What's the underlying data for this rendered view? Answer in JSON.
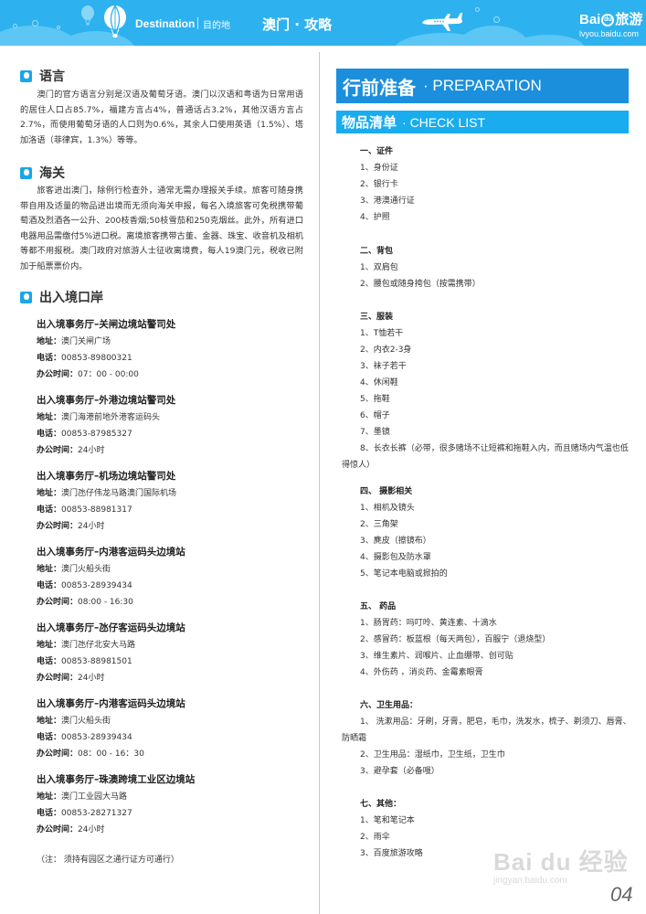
{
  "header": {
    "destination_label": "Destination",
    "destination_cn": "目的地",
    "title": "澳门 · 攻略",
    "logo_main": "Bai",
    "logo_paw": "du",
    "logo_cn": "旅游",
    "logo_url": "lvyou.baidu.com"
  },
  "left": {
    "language": {
      "title": "语言",
      "body": "澳门的官方语言分别是汉语及葡萄牙语。澳门以汉语和粤语为日常用语的居住人口占85.7%，福建方言占4%，普通话占3.2%，其他汉语方言占2.7%，而使用葡萄牙语的人口则为0.6%，其余人口使用英语（1.5%）、塔加洛语（菲律宾，1.3%）等等。"
    },
    "customs": {
      "title": "海关",
      "body": "旅客进出澳门，除例行检查外，通常无需办理报关手续。旅客可随身携带自用及适量的物品进出境而无须向海关申报，每名入境旅客可免税携带葡萄酒及烈酒各一公升、200枝香烟;50枝雪茄和250克烟丝。此外，所有进口电器用品需缴付5%进口税。离境旅客携带古董、金器、珠宝、收音机及相机等都不用报税。澳门政府对旅游人士征收离境费，每人19澳门元，税收已附加于船票票价内。"
    },
    "ports": {
      "title": "出入境口岸",
      "labels": {
        "address": "地址：",
        "phone": "电话：",
        "hours": "办公时间："
      },
      "offices": [
        {
          "name": "出入境事务厅–关闸边境站警司处",
          "address": "澳门关闸广场",
          "phone": "00853-89800321",
          "hours": "07：00 - 00:00"
        },
        {
          "name": "出入境事务厅–外港边境站警司处",
          "address": "澳门海港前地外港客运码头",
          "phone": "00853-87985327",
          "hours": "24小时"
        },
        {
          "name": "出入境事务厅–机场边境站警司处",
          "address": "澳门氹仔伟龙马路澳门国际机场",
          "phone": "00853-88981317",
          "hours": "24小时"
        },
        {
          "name": "出入境事务厅–内港客运码头边境站",
          "address": "澳门火船头街",
          "phone": "00853-28939434",
          "hours": "08:00 - 16:30"
        },
        {
          "name": "出入境事务厅–氹仔客运码头边境站",
          "address": "澳门氹仔北安大马路",
          "phone": "00853-88981501",
          "hours": "24小时"
        },
        {
          "name": "出入境事务厅–内港客运码头边境站",
          "address": "澳门火船头街",
          "phone": "00853-28939434",
          "hours": "08：00 - 16：30"
        },
        {
          "name": "出入境事务厅–珠澳跨境工业区边境站",
          "address": "澳门工业园大马路",
          "phone": "00853-28271327",
          "hours": "24小时"
        }
      ],
      "note": "（注： 须持有园区之通行证方可通行）"
    }
  },
  "right": {
    "banner_main_cn": "行前准备",
    "banner_main_en": "· PREPARATION",
    "banner_sub_cn": "物品清单",
    "banner_sub_en": "· CHECK LIST",
    "categories": [
      {
        "title": "一、证件",
        "items": [
          "1、身份证",
          "2、银行卡",
          "3、港澳通行证",
          "4、护照"
        ]
      },
      {
        "title": "二、背包",
        "items": [
          "1、双肩包",
          "2、腰包或随身挎包（按需携带）"
        ]
      },
      {
        "title": "三、服装",
        "items": [
          "1、T恤若干",
          "2、内衣2-3身",
          "3、袜子若干",
          "4、休闲鞋",
          "5、拖鞋",
          "6、帽子",
          "7、墨镜",
          "8、长衣长裤（必带，很多赌场不让短裤和拖鞋入内，而且赌场内气温也低得惊人）"
        ]
      },
      {
        "title": "四、 摄影相关",
        "items": [
          "1、相机及镜头",
          "2、三角架",
          "3、麂皮（擦镜布）",
          "4、摄影包及防水罩",
          "5、笔记本电脑或掀拍的"
        ]
      },
      {
        "title": "五、 药品",
        "items": [
          "1、肠胃药：吗叮呤、黄连素、十滴水",
          "2、感冒药：板蓝根（每天两包），百服宁（退烧型）",
          "3、维生素片、润喉片、止血绷带、创可贴",
          "4、外伤药 ，消炎药、金霉素眼膏"
        ]
      },
      {
        "title": "六、卫生用品：",
        "items": [
          "1、 洗漱用品：牙刷，牙膏，肥皂，毛巾，洗发水，梳子、剃须刀、唇膏、防晒霜",
          "2、卫生用品：湿纸巾，卫生纸，卫生巾",
          "3、避孕套（必备哦）"
        ]
      },
      {
        "title": "七、其他：",
        "items": [
          "1、笔和笔记本",
          "2、雨伞",
          "3、百度旅游攻略"
        ]
      }
    ]
  },
  "watermark": {
    "main": "Bai du 经验",
    "sub": "jingyan.baidu.com"
  },
  "page_number": "04"
}
